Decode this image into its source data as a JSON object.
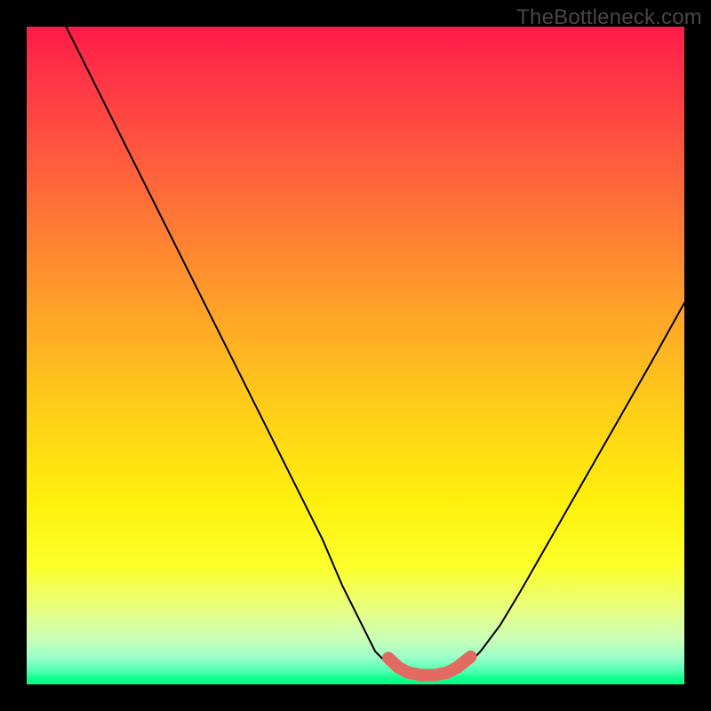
{
  "watermark": "TheBottleneck.com",
  "colors": {
    "frame": "#000000",
    "curve": "#000000",
    "marker": "#e26a61",
    "gradient_top": "#ff1a4a",
    "gradient_bottom": "#00ff82"
  },
  "chart_data": {
    "type": "line",
    "title": "",
    "xlabel": "",
    "ylabel": "",
    "xlim": [
      0,
      100
    ],
    "ylim": [
      0,
      100
    ],
    "grid": false,
    "legend": false,
    "series": [
      {
        "name": "left-curve",
        "x": [
          6,
          10,
          15,
          20,
          25,
          30,
          35,
          40,
          45,
          48,
          51,
          53,
          55,
          57
        ],
        "y": [
          100,
          92,
          82,
          72,
          62,
          52,
          42,
          32,
          22,
          15,
          9,
          5,
          3,
          1.5
        ]
      },
      {
        "name": "right-curve",
        "x": [
          65,
          67,
          69,
          72,
          75,
          79,
          83,
          87,
          91,
          95,
          100
        ],
        "y": [
          1.5,
          3,
          5,
          9,
          14,
          21,
          28,
          35,
          42,
          49,
          58
        ]
      },
      {
        "name": "trough-marker",
        "x": [
          55,
          56.5,
          58,
          60,
          62,
          64,
          65.5,
          66.5,
          67.5
        ],
        "y": [
          4.0,
          2.6,
          1.8,
          1.4,
          1.4,
          1.8,
          2.6,
          3.4,
          4.2
        ]
      }
    ]
  }
}
